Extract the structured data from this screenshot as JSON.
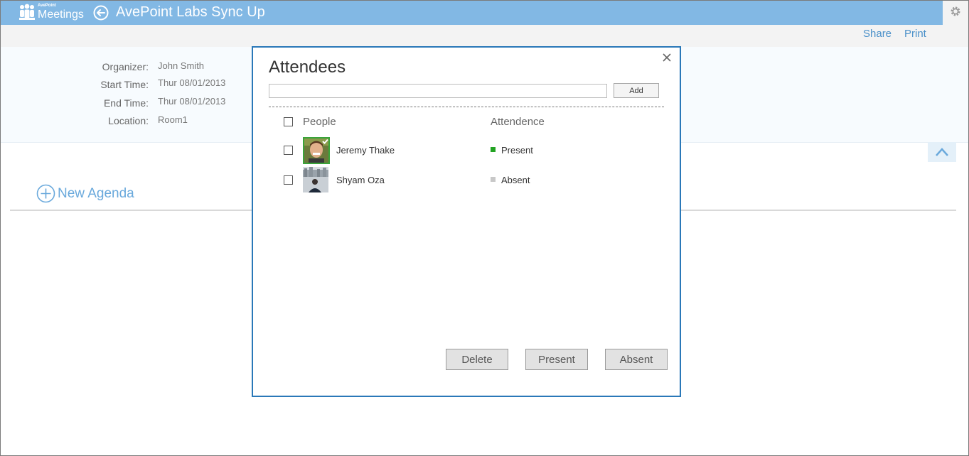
{
  "app": {
    "brand": "AvePoint",
    "name": "Meetings",
    "meeting_title": "AvePoint Labs Sync Up"
  },
  "toolbar": {
    "share": "Share",
    "print": "Print"
  },
  "details": {
    "organizer_label": "Organizer:",
    "organizer": "John Smith",
    "start_label": "Start Time:",
    "start": "Thur 08/01/2013",
    "end_label": "End Time:",
    "end": "Thur 08/01/2013",
    "location_label": "Location:",
    "location": "Room1"
  },
  "agenda": {
    "new_label": "New Agenda"
  },
  "dialog": {
    "title": "Attendees",
    "add_value": "",
    "add_button": "Add",
    "col_people": "People",
    "col_attendance": "Attendence",
    "attendees": [
      {
        "name": "Jeremy Thake",
        "status": "Present",
        "status_color": "#22a322"
      },
      {
        "name": "Shyam Oza",
        "status": "Absent",
        "status_color": "#c8c8c8"
      }
    ],
    "buttons": {
      "delete": "Delete",
      "present": "Present",
      "absent": "Absent"
    }
  },
  "colors": {
    "header": "#82b8e4",
    "dialog_border": "#2a78b8",
    "link": "#4a90c9"
  }
}
